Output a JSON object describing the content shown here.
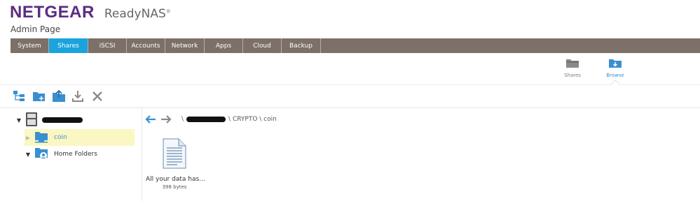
{
  "header": {
    "brand": "NETGEAR",
    "product": "ReadyNAS",
    "trademark": "®",
    "subtitle": "Admin Page"
  },
  "nav": {
    "tabs": [
      {
        "label": "System"
      },
      {
        "label": "Shares"
      },
      {
        "label": "iSCSI"
      },
      {
        "label": "Accounts"
      },
      {
        "label": "Network"
      },
      {
        "label": "Apps"
      },
      {
        "label": "Cloud"
      },
      {
        "label": "Backup"
      }
    ],
    "active": "Shares"
  },
  "view_toggle": {
    "shares_label": "Shares",
    "browse_label": "Browse",
    "active": "Browse"
  },
  "toolbar": {
    "buttons": [
      {
        "icon": "tree-view-icon"
      },
      {
        "icon": "new-folder-icon"
      },
      {
        "icon": "upload-icon"
      },
      {
        "icon": "download-icon"
      },
      {
        "icon": "delete-icon"
      }
    ]
  },
  "tree": {
    "root_label_redacted": true,
    "items": [
      {
        "label": "coin",
        "selected": true
      },
      {
        "label": "Home Folders",
        "selected": false
      }
    ]
  },
  "path": {
    "separator": "\\",
    "segments_visible": [
      "CRYPTO",
      "coin"
    ],
    "display_tail": "\\ CRYPTO \\ coin"
  },
  "files": [
    {
      "name": "All your data has...",
      "size": "398 bytes",
      "icon": "text-document-icon"
    }
  ],
  "colors": {
    "brand_purple": "#5a2d82",
    "nav_bg": "#7d7068",
    "nav_active": "#1aa3dc",
    "icon_blue": "#3a8fd0",
    "selection_bg": "#fbf7c2"
  }
}
